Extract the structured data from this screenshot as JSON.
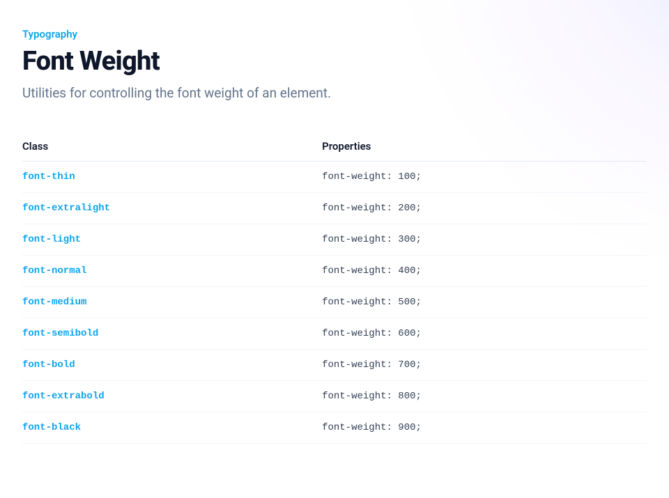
{
  "category": "Typography",
  "title": "Font Weight",
  "description": "Utilities for controlling the font weight of an element.",
  "table": {
    "headers": {
      "class": "Class",
      "properties": "Properties"
    },
    "rows": [
      {
        "class": "font-thin",
        "properties": "font-weight: 100;"
      },
      {
        "class": "font-extralight",
        "properties": "font-weight: 200;"
      },
      {
        "class": "font-light",
        "properties": "font-weight: 300;"
      },
      {
        "class": "font-normal",
        "properties": "font-weight: 400;"
      },
      {
        "class": "font-medium",
        "properties": "font-weight: 500;"
      },
      {
        "class": "font-semibold",
        "properties": "font-weight: 600;"
      },
      {
        "class": "font-bold",
        "properties": "font-weight: 700;"
      },
      {
        "class": "font-extrabold",
        "properties": "font-weight: 800;"
      },
      {
        "class": "font-black",
        "properties": "font-weight: 900;"
      }
    ]
  }
}
